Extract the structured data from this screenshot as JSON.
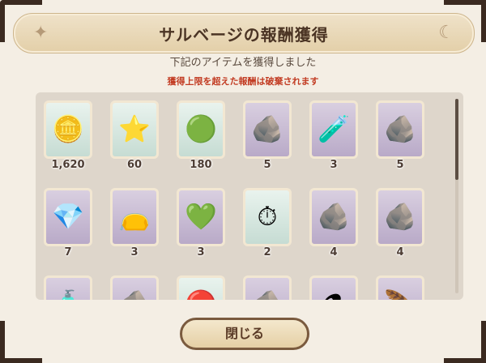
{
  "dialog": {
    "title": "サルベージの報酬獲得",
    "subtitle": "下記のアイテムを獲得しました",
    "warning": "獲得上限を超えた報酬は破棄されます",
    "close_label": "閉じる"
  },
  "rewards": [
    {
      "icon": "coin-icon",
      "glyph": "🪙",
      "qty": "1,620",
      "frame": "teal"
    },
    {
      "icon": "star-icon",
      "glyph": "⭐",
      "qty": "60",
      "frame": "teal"
    },
    {
      "icon": "green-orb-icon",
      "glyph": "🟢",
      "qty": "180",
      "frame": "teal"
    },
    {
      "icon": "stone-fragment-icon",
      "glyph": "🪨",
      "qty": "5",
      "frame": "lav"
    },
    {
      "icon": "potion-quill-icon",
      "glyph": "🧪",
      "qty": "3",
      "frame": "lav"
    },
    {
      "icon": "stone-fragment-icon",
      "glyph": "🪨",
      "qty": "5",
      "frame": "lav"
    },
    {
      "icon": "blue-crystal-icon",
      "glyph": "💎",
      "qty": "7",
      "frame": "lav"
    },
    {
      "icon": "pouch-icon",
      "glyph": "👝",
      "qty": "3",
      "frame": "lav"
    },
    {
      "icon": "green-crystal-icon",
      "glyph": "💚",
      "qty": "3",
      "frame": "lav"
    },
    {
      "icon": "pocket-watch-icon",
      "glyph": "⏱",
      "qty": "2",
      "frame": "teal"
    },
    {
      "icon": "stone-fragment-icon",
      "glyph": "🪨",
      "qty": "4",
      "frame": "lav"
    },
    {
      "icon": "stone-fragment-icon",
      "glyph": "🪨",
      "qty": "4",
      "frame": "lav"
    },
    {
      "icon": "potion-icon",
      "glyph": "🧴",
      "qty": "",
      "frame": "lav"
    },
    {
      "icon": "stone-fragment-icon",
      "glyph": "🪨",
      "qty": "",
      "frame": "lav"
    },
    {
      "icon": "red-item-icon",
      "glyph": "🔴",
      "qty": "",
      "frame": "teal"
    },
    {
      "icon": "stone-fragment-icon",
      "glyph": "🪨",
      "qty": "",
      "frame": "lav"
    },
    {
      "icon": "flask-icon",
      "glyph": "⚗",
      "qty": "",
      "frame": "lav"
    },
    {
      "icon": "quill-icon",
      "glyph": "🪶",
      "qty": "",
      "frame": "lav"
    }
  ],
  "colors": {
    "warning": "#c23b22",
    "title_text": "#4b3424",
    "panel": "#ded6cb"
  }
}
